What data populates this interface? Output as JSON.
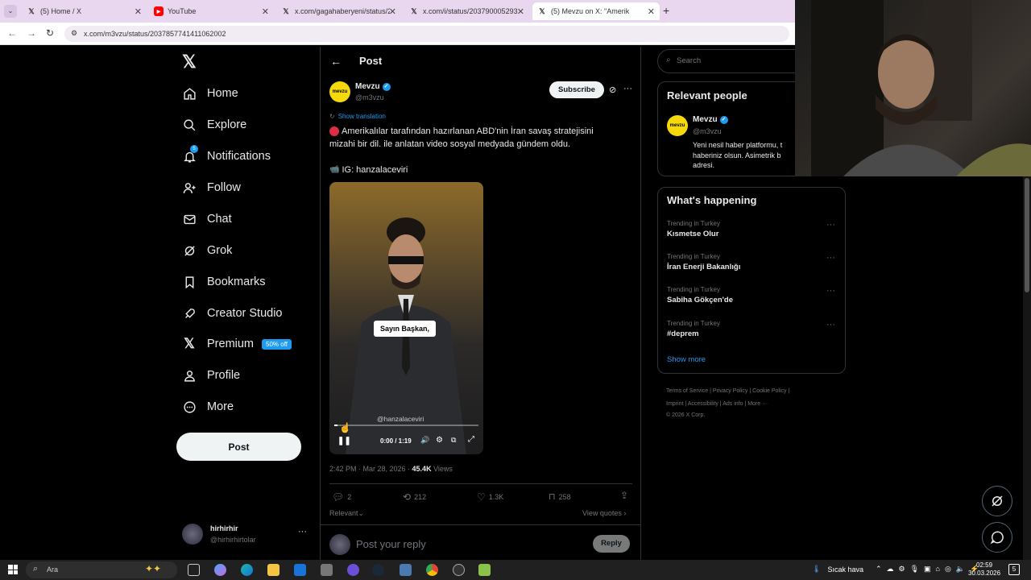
{
  "browser": {
    "tabs": [
      {
        "label": "(5) Home / X",
        "icon": "x-logo"
      },
      {
        "label": "YouTube",
        "icon": "youtube-logo"
      },
      {
        "label": "x.com/gagahaberyeni/status/20",
        "icon": "x-logo"
      },
      {
        "label": "x.com/i/status/20379000529333",
        "icon": "x-logo"
      },
      {
        "label": "(5) Mevzu on X: \"Amerik",
        "icon": "x-logo"
      }
    ],
    "url": "x.com/m3vzu/status/2037857741411062002"
  },
  "nav": {
    "items": [
      {
        "label": "Home",
        "icon": "home-icon"
      },
      {
        "label": "Explore",
        "icon": "search-icon"
      },
      {
        "label": "Notifications",
        "icon": "bell-icon",
        "badge": "5"
      },
      {
        "label": "Follow",
        "icon": "follow-icon"
      },
      {
        "label": "Chat",
        "icon": "mail-icon"
      },
      {
        "label": "Grok",
        "icon": "grok-icon"
      },
      {
        "label": "Bookmarks",
        "icon": "bookmark-icon"
      },
      {
        "label": "Creator Studio",
        "icon": "rocket-icon"
      },
      {
        "label": "Premium",
        "icon": "x-icon",
        "badge": "50% off"
      },
      {
        "label": "Profile",
        "icon": "person-icon"
      },
      {
        "label": "More",
        "icon": "more-circle-icon"
      }
    ],
    "post_label": "Post",
    "account": {
      "name": "hirhirhir",
      "handle": "@hirhirhirtolar"
    }
  },
  "post": {
    "header": "Post",
    "author_name": "Mevzu",
    "author_handle": "@m3vzu",
    "avatar_text": "mevzu",
    "subscribe_label": "Subscribe",
    "show_translation": "Show translation",
    "text_line1": "Amerikalılar tarafından hazırlanan ABD'nin İran savaş stratejisini",
    "text_line2": "mizahi bir dil. ile anlatan video sosyal medyada gündem oldu.",
    "text_line3": "IG: hanzalaceviri",
    "video": {
      "caption": "Sayın Başkan,",
      "watermark": "@hanzalaceviri",
      "time": "0:00 / 1:19",
      "progress": 0.02
    },
    "timestamp": "2:42 PM · Mar 28, 2026 · ",
    "views_count": "45.4K",
    "views_label": " Views",
    "stats": {
      "replies": "2",
      "reposts": "212",
      "likes": "1.3K",
      "bookmarks": "258"
    },
    "relevant_label": "Relevant",
    "view_quotes": "View quotes",
    "reply_placeholder": "Post your reply",
    "reply_button": "Reply"
  },
  "sidebar": {
    "search_placeholder": "Search",
    "relevant_title": "Relevant people",
    "person": {
      "name": "Mevzu",
      "handle": "@m3vzu",
      "bio_line1": "Yeni nesil haber platformu, t",
      "bio_line2": "haberiniz olsun. Asimetrik b",
      "bio_line3": "adresi."
    },
    "happening_title": "What's happening",
    "trends": [
      {
        "context": "Trending in Turkey",
        "title": "Kısmetse Olur"
      },
      {
        "context": "Trending in Turkey",
        "title": "İran Enerji Bakanlığı"
      },
      {
        "context": "Trending in Turkey",
        "title": "Sabiha Gökçen'de"
      },
      {
        "context": "Trending in Turkey",
        "title": "#deprem"
      }
    ],
    "show_more": "Show more",
    "footer_line1": [
      "Terms of Service",
      "Privacy Policy",
      "Cookie Policy"
    ],
    "footer_line2": [
      "Imprint",
      "Accessibility",
      "Ads info",
      "More ···"
    ],
    "copyright": "© 2026 X Corp."
  },
  "taskbar": {
    "search_label": "Ara",
    "weather": "Sıcak hava",
    "time": "02:59",
    "date": "30.03.2026",
    "notification_count": "5"
  },
  "colors": {
    "accent": "#1d9bf0",
    "avatar": "#f5d90a"
  }
}
